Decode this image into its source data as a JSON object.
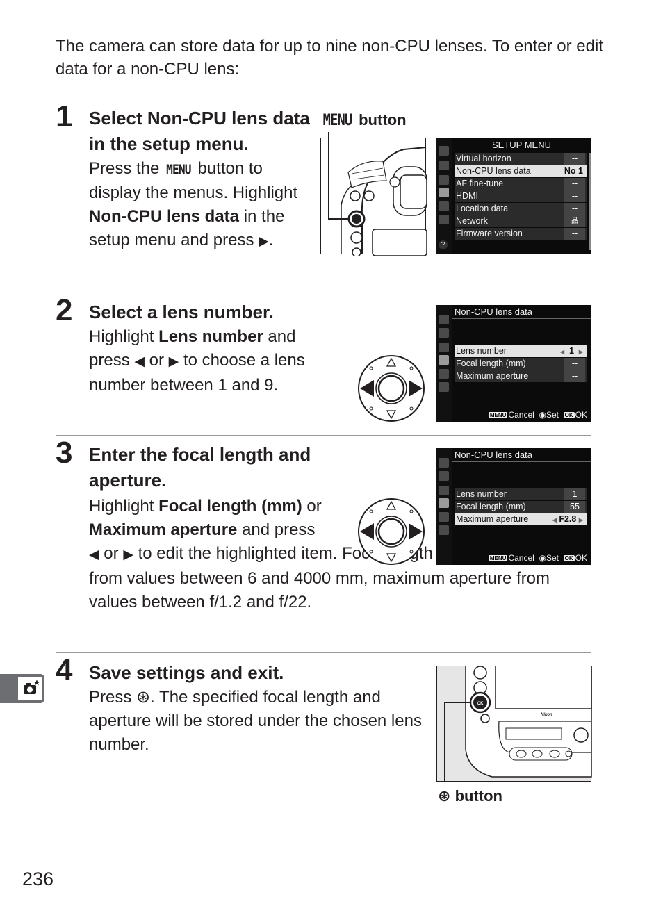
{
  "intro": "The camera can store data for up to nine non-CPU lenses.  To enter or edit data for a non-CPU lens:",
  "page_number": "236",
  "side_tab_icon": "custom-shooting-camera-star-icon",
  "steps": [
    {
      "number": "1",
      "title_parts": [
        "Select ",
        "Non-CPU lens data",
        " in the setup menu."
      ],
      "body_parts": [
        "Press the ",
        "MENU",
        " button to display the menus.  Highlight ",
        "Non-CPU lens data",
        " in the setup menu and press ",
        "▶",
        "."
      ],
      "callout": {
        "glyph": "MENU",
        "label": "button"
      },
      "screen": {
        "title": "SETUP MENU",
        "rows": [
          {
            "label": "Virtual horizon",
            "value": "--"
          },
          {
            "label": "Non-CPU lens data",
            "value": "No 1",
            "highlighted": true
          },
          {
            "label": "AF fine-tune",
            "value": "--"
          },
          {
            "label": "HDMI",
            "value": "--"
          },
          {
            "label": "Location data",
            "value": "--"
          },
          {
            "label": "Network",
            "value": "品"
          },
          {
            "label": "Firmware version",
            "value": "--"
          }
        ],
        "help": "?"
      }
    },
    {
      "number": "2",
      "title": "Select a lens number.",
      "body_parts": [
        "Highlight ",
        "Lens number",
        " and press ",
        "◀",
        " or ",
        "▶",
        " to choose a lens number between 1 and 9."
      ],
      "screen": {
        "title": "Non-CPU lens data",
        "rows": [
          {
            "label": "Lens number",
            "value": "1",
            "highlighted": true
          },
          {
            "label": "Focal length (mm)",
            "value": "--"
          },
          {
            "label": "Maximum aperture",
            "value": "--"
          }
        ],
        "footer": {
          "cancel_key": "MENU",
          "cancel": "Cancel",
          "set": "Set",
          "ok_key": "OK",
          "ok": "OK"
        }
      }
    },
    {
      "number": "3",
      "title": "Enter the focal length and aperture.",
      "body_parts": [
        "Highlight ",
        "Focal length (mm)",
        " or ",
        "Maximum aperture",
        " and press ",
        "◀",
        " or ",
        "▶",
        " to edit the highlighted item.  Focal length can be selected from values between 6 and 4000 mm, maximum aperture from values between f/1.2 and f/22."
      ],
      "screen": {
        "title": "Non-CPU lens data",
        "rows": [
          {
            "label": "Lens number",
            "value": "1"
          },
          {
            "label": "Focal length (mm)",
            "value": "55"
          },
          {
            "label": "Maximum aperture",
            "value": "F2.8",
            "highlighted": true
          }
        ],
        "footer": {
          "cancel_key": "MENU",
          "cancel": "Cancel",
          "set": "Set",
          "ok_key": "OK",
          "ok": "OK"
        }
      }
    },
    {
      "number": "4",
      "title": "Save settings and exit.",
      "body_parts": [
        "Press ",
        "⊛",
        ".  The specified focal length and aperture will be stored under the chosen lens number."
      ],
      "callout": {
        "glyph": "OK",
        "label": "button"
      }
    }
  ]
}
